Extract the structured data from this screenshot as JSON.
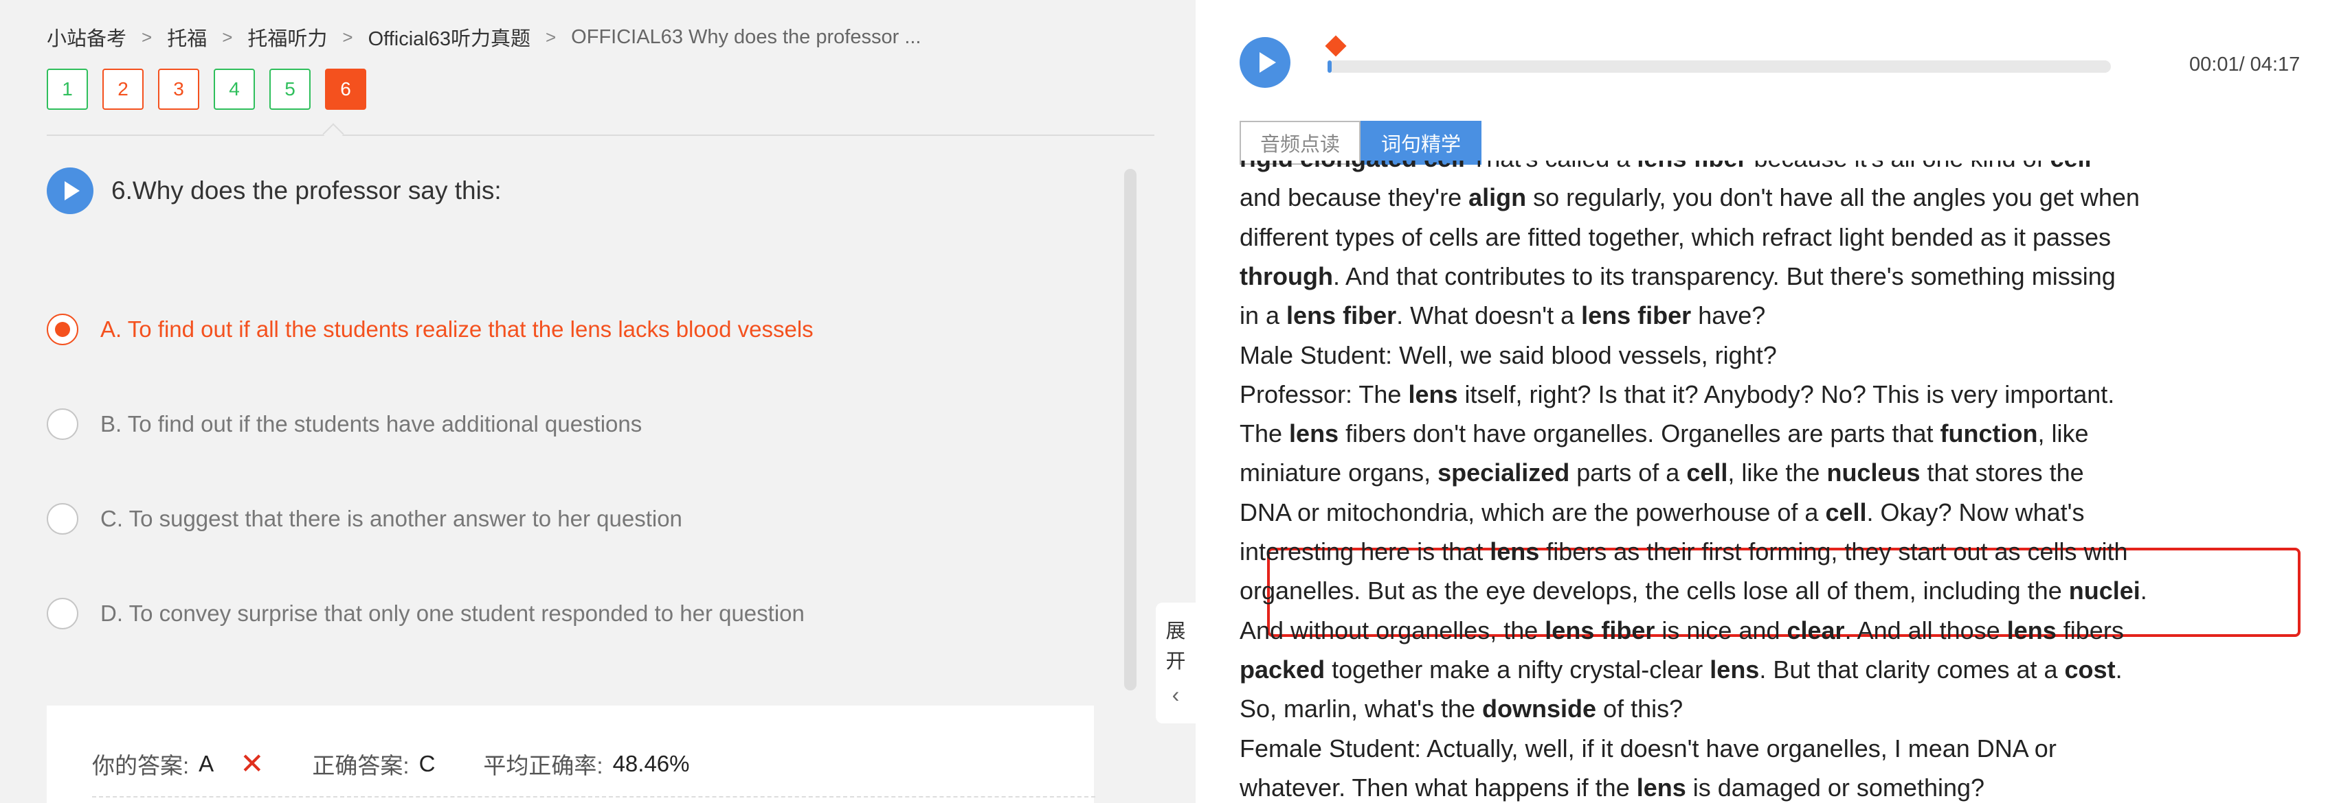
{
  "breadcrumb": {
    "items": [
      "小站备考",
      "托福",
      "托福听力",
      "Official63听力真题"
    ],
    "current": "OFFICIAL63 Why does the professor ...",
    "separator": ">"
  },
  "question_numbers": [
    {
      "label": "1",
      "state": "correct"
    },
    {
      "label": "2",
      "state": "wrong"
    },
    {
      "label": "3",
      "state": "wrong"
    },
    {
      "label": "4",
      "state": "correct"
    },
    {
      "label": "5",
      "state": "correct"
    },
    {
      "label": "6",
      "state": "current"
    }
  ],
  "question": {
    "title": "6.Why does the professor say this:",
    "options": [
      {
        "text": "A. To find out if all the students realize that the lens lacks blood vessels",
        "selected": true
      },
      {
        "text": "B. To find out if the students have additional questions",
        "selected": false
      },
      {
        "text": "C. To suggest that there is another answer to her question",
        "selected": false
      },
      {
        "text": "D. To convey surprise that only one student responded to her question",
        "selected": false
      }
    ]
  },
  "answer": {
    "your_label": "你的答案:",
    "your_value": "A",
    "wrong_mark": "✕",
    "correct_label": "正确答案:",
    "correct_value": "C",
    "rate_label": "平均正确率:",
    "rate_value": "48.46%"
  },
  "side_handle": {
    "line1": "展",
    "line2": "开",
    "chevron": "‹"
  },
  "player": {
    "time": "00:01/ 04:17",
    "progress": 0.004
  },
  "tabs": [
    {
      "label": "音频点读",
      "active": false
    },
    {
      "label": "词句精学",
      "active": true
    }
  ],
  "transcript": {
    "lines": [
      [
        {
          "t": "rigid elongated cell",
          "b": true
        },
        {
          "t": " That's called a "
        },
        {
          "t": "lens fiber",
          "b": true
        },
        {
          "t": " because it's all one kind of "
        },
        {
          "t": "cell",
          "b": true
        }
      ],
      [
        {
          "t": "and because they're "
        },
        {
          "t": "align",
          "b": true
        },
        {
          "t": " so regularly, you don't have all the angles you get when"
        }
      ],
      [
        {
          "t": "different types of cells are fitted together, which refract light bended as it passes"
        }
      ],
      [
        {
          "t": "through",
          "b": true
        },
        {
          "t": ". And that contributes to its transparency. But there's something missing"
        }
      ],
      [
        {
          "t": "in a "
        },
        {
          "t": "lens fiber",
          "b": true
        },
        {
          "t": ". What doesn't a "
        },
        {
          "t": "lens fiber",
          "b": true
        },
        {
          "t": " have?"
        }
      ],
      [
        {
          "t": "Male Student: Well, we said blood vessels, right?"
        }
      ],
      [
        {
          "t": "Professor: The "
        },
        {
          "t": "lens",
          "b": true
        },
        {
          "t": " itself, right? Is that it? Anybody? No? This is very important."
        }
      ],
      [
        {
          "t": "The "
        },
        {
          "t": "lens",
          "b": true
        },
        {
          "t": " fibers don't have organelles. Organelles are parts that "
        },
        {
          "t": "function",
          "b": true
        },
        {
          "t": ", like"
        }
      ],
      [
        {
          "t": "miniature organs, "
        },
        {
          "t": "specialized",
          "b": true
        },
        {
          "t": " parts of a "
        },
        {
          "t": "cell",
          "b": true
        },
        {
          "t": ", like the "
        },
        {
          "t": "nucleus",
          "b": true
        },
        {
          "t": " that stores the"
        }
      ],
      [
        {
          "t": "DNA or mitochondria, which are the powerhouse of a "
        },
        {
          "t": "cell",
          "b": true
        },
        {
          "t": ". Okay? Now what's"
        }
      ],
      [
        {
          "t": "interesting here is that "
        },
        {
          "t": "lens",
          "b": true
        },
        {
          "t": " fibers as their first forming, they start out as cells with"
        }
      ],
      [
        {
          "t": "organelles. But as the eye develops, the cells lose all of them, including the "
        },
        {
          "t": "nuclei",
          "b": true
        },
        {
          "t": "."
        }
      ],
      [
        {
          "t": "And without organelles, the "
        },
        {
          "t": "lens fiber",
          "b": true
        },
        {
          "t": " is nice and "
        },
        {
          "t": "clear",
          "b": true
        },
        {
          "t": ". And all those "
        },
        {
          "t": "lens",
          "b": true
        },
        {
          "t": " fibers"
        }
      ],
      [
        {
          "t": "packed",
          "b": true
        },
        {
          "t": " together make a nifty crystal-clear "
        },
        {
          "t": "lens",
          "b": true
        },
        {
          "t": ". But that clarity comes at a "
        },
        {
          "t": "cost",
          "b": true
        },
        {
          "t": "."
        }
      ],
      [
        {
          "t": "So, marlin, what's the "
        },
        {
          "t": "downside",
          "b": true
        },
        {
          "t": " of this?"
        }
      ],
      [
        {
          "t": "Female Student: Actually, well, if it doesn't have organelles, I mean DNA or"
        }
      ],
      [
        {
          "t": "whatever. Then what happens if the "
        },
        {
          "t": "lens",
          "b": true
        },
        {
          "t": " is damaged or something?"
        }
      ]
    ]
  },
  "colors": {
    "accent_blue": "#4a90e2",
    "accent_orange": "#f4511e",
    "correct_green": "#2fbf5c",
    "highlight_red": "#e4231b"
  }
}
